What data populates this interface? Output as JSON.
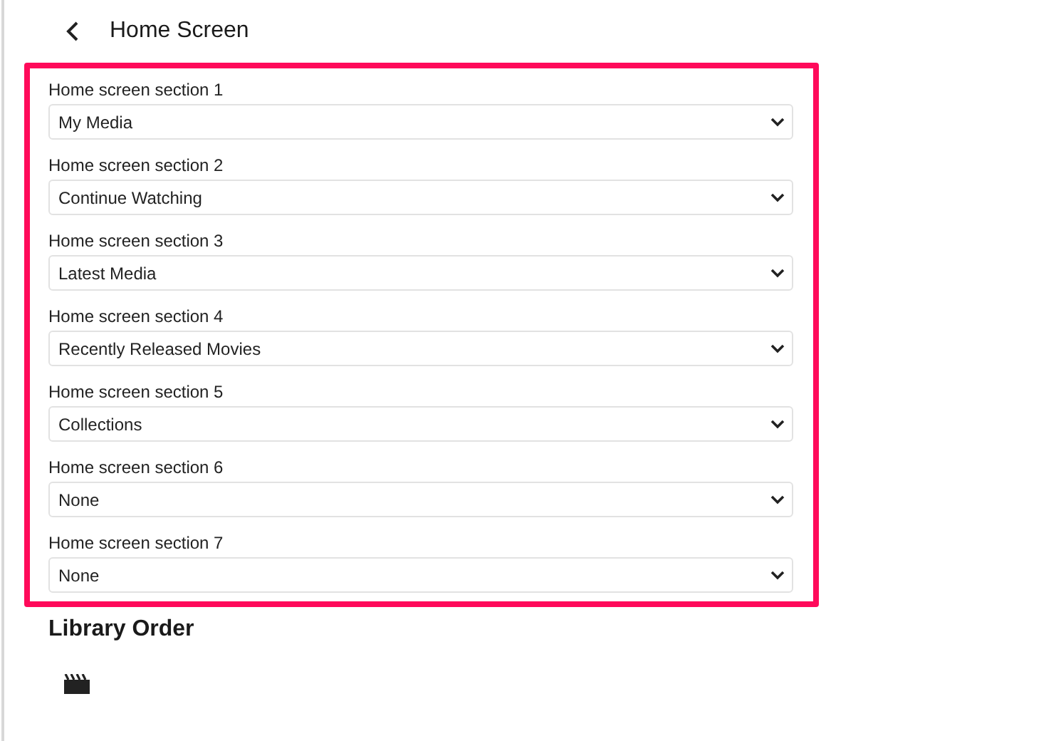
{
  "header": {
    "title": "Home Screen"
  },
  "sections": [
    {
      "label": "Home screen section 1",
      "value": "My Media"
    },
    {
      "label": "Home screen section 2",
      "value": "Continue Watching"
    },
    {
      "label": "Home screen section 3",
      "value": "Latest Media"
    },
    {
      "label": "Home screen section 4",
      "value": "Recently Released Movies"
    },
    {
      "label": "Home screen section 5",
      "value": "Collections"
    },
    {
      "label": "Home screen section 6",
      "value": "None"
    },
    {
      "label": "Home screen section 7",
      "value": "None"
    }
  ],
  "library_order": {
    "heading": "Library Order"
  }
}
